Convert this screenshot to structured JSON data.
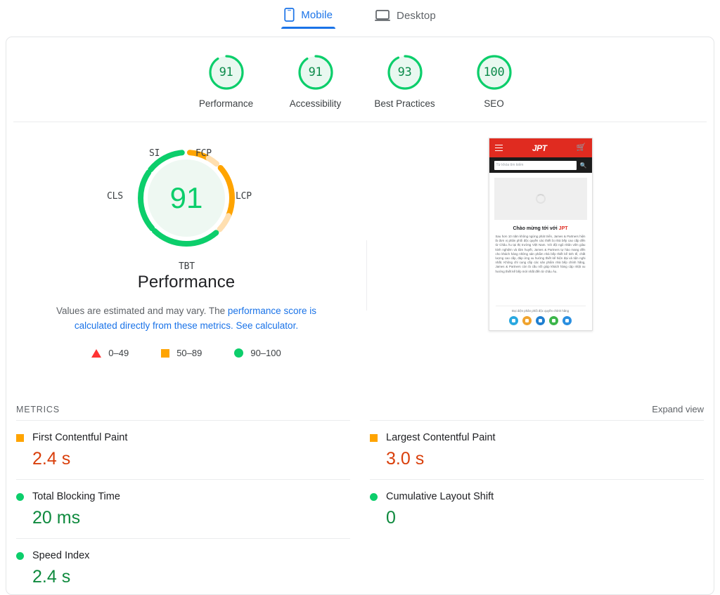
{
  "tabs": [
    {
      "id": "mobile",
      "label": "Mobile",
      "icon": "phone-icon",
      "active": true
    },
    {
      "id": "desktop",
      "label": "Desktop",
      "icon": "laptop-icon",
      "active": false
    }
  ],
  "category_scores": [
    {
      "label": "Performance",
      "score": "91"
    },
    {
      "label": "Accessibility",
      "score": "91"
    },
    {
      "label": "Best Practices",
      "score": "93"
    },
    {
      "label": "SEO",
      "score": "100"
    }
  ],
  "performance_gauge": {
    "score": "91",
    "title": "Performance",
    "arc_labels": {
      "si": "SI",
      "fcp": "FCP",
      "cls": "CLS",
      "lcp": "LCP",
      "tbt": "TBT"
    }
  },
  "note": {
    "text_before": "Values are estimated and may vary. The ",
    "link1": "performance score is calculated directly from these metrics.",
    "link2": "See calculator."
  },
  "legend": [
    {
      "shape": "triangle",
      "range": "0–49",
      "color": "#ff3333"
    },
    {
      "shape": "square",
      "range": "50–89",
      "color": "#ffa400"
    },
    {
      "shape": "circle",
      "range": "90–100",
      "color": "#0cce6b"
    }
  ],
  "metrics_section": {
    "title": "METRICS",
    "expand_label": "Expand view",
    "items": [
      {
        "name": "First Contentful Paint",
        "value": "2.4 s",
        "status": "average",
        "marker": "square"
      },
      {
        "name": "Largest Contentful Paint",
        "value": "3.0 s",
        "status": "average",
        "marker": "square"
      },
      {
        "name": "Total Blocking Time",
        "value": "20 ms",
        "status": "good",
        "marker": "circle"
      },
      {
        "name": "Cumulative Layout Shift",
        "value": "0",
        "status": "good",
        "marker": "circle"
      },
      {
        "name": "Speed Index",
        "value": "2.4 s",
        "status": "good",
        "marker": "circle"
      }
    ]
  },
  "thumbnail": {
    "logo": "JPT",
    "search_placeholder": "Từ khóa tìm kiếm",
    "heading_prefix": "Chào mừng tới với ",
    "heading_brand": "JPT",
    "body": "Sau hơn 10 năm không ngừng phát triển, James & Partners hiện là đơn vị phân phối độc quyền các thiết bị nhà bếp cao cấp đến từ Châu Âu tại thị trường Việt Nam. Với đội ngũ nhân viên giàu kinh nghiệm và tâm huyết, James & Partners tự hào mang đến cho khách hàng những sản phẩm nhà bếp thiết kế tinh tế, chất lượng cao cấp, đáp ứng xu hướng thiết kế hiện đại và tiện nghi nhất. Không chỉ cung cấp các sản phẩm nhà bếp chính hãng, James & Partners còn là cầu nối giúp khách hàng cập nhật xu hướng thiết kế bếp mới nhất đến từ châu Âu.",
    "footer": "Đại diện phân phối độc quyền chính hãng",
    "social_colors": [
      "#29a8e0",
      "#f0a32e",
      "#1f7fd0",
      "#3bb54a",
      "#2a8fe0"
    ]
  }
}
